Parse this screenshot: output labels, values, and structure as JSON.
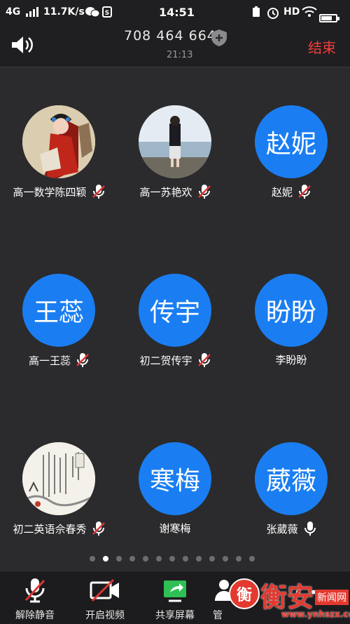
{
  "status_bar": {
    "network": "4G",
    "speed": "11.7K/s",
    "time": "14:51",
    "hd": "HD"
  },
  "header": {
    "meeting_id": "708 464 664",
    "duration": "21:13",
    "end_label": "结束"
  },
  "participants": [
    {
      "name": "高一数学陈四颖",
      "avatar_text": "",
      "avatar_type": "photo-opera",
      "mic": "muted"
    },
    {
      "name": "高一苏艳欢",
      "avatar_text": "",
      "avatar_type": "photo-sea",
      "mic": "muted"
    },
    {
      "name": "赵妮",
      "avatar_text": "赵妮",
      "avatar_type": "text",
      "mic": "muted"
    },
    {
      "name": "高一王蕊",
      "avatar_text": "王蕊",
      "avatar_type": "text",
      "mic": "muted"
    },
    {
      "name": "初二贺传宇",
      "avatar_text": "传宇",
      "avatar_type": "text",
      "mic": "muted"
    },
    {
      "name": "李盼盼",
      "avatar_text": "盼盼",
      "avatar_type": "text",
      "mic": "none"
    },
    {
      "name": "初二英语佘春秀",
      "avatar_text": "",
      "avatar_type": "photo-calligraphy",
      "mic": "muted"
    },
    {
      "name": "谢寒梅",
      "avatar_text": "寒梅",
      "avatar_type": "text",
      "mic": "none"
    },
    {
      "name": "张葳薇",
      "avatar_text": "葳薇",
      "avatar_type": "text",
      "mic": "on"
    }
  ],
  "pagination": {
    "total": 13,
    "current": 2
  },
  "toolbar": {
    "unmute_label": "解除静音",
    "video_label": "开启视频",
    "share_label": "共享屏幕",
    "manage_label": "管"
  },
  "watermark": {
    "seal": "衡",
    "big": "衡安",
    "news": "新闻网",
    "url": "www.ynhszx.com"
  },
  "colors": {
    "accent": "#1a7ef2",
    "end": "#f23c3c",
    "muted": "#e03434"
  }
}
